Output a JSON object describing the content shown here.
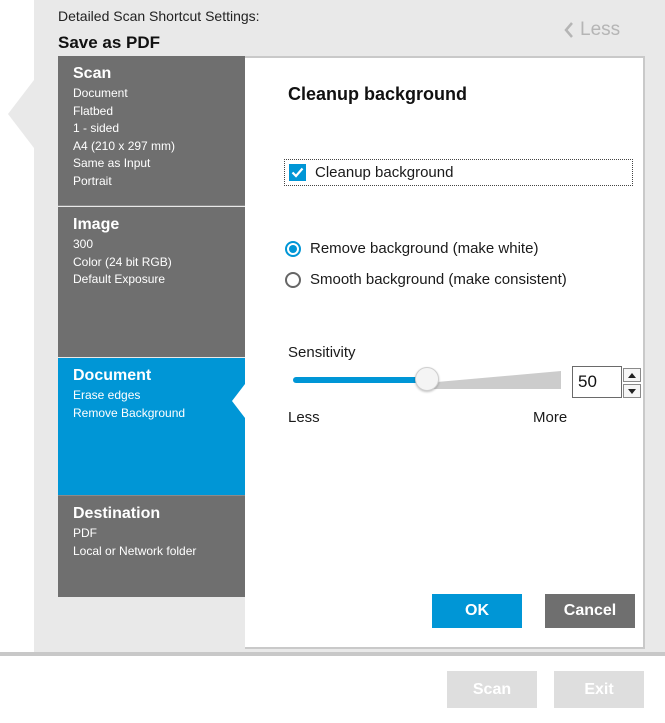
{
  "header": {
    "subtitle": "Detailed Scan Shortcut Settings:",
    "title": "Save as PDF",
    "less_label": "Less"
  },
  "sidebar": {
    "items": [
      {
        "title": "Scan",
        "lines": [
          "Document",
          "Flatbed",
          "1 - sided",
          "A4 (210 x 297 mm)",
          "Same as Input",
          "Portrait"
        ]
      },
      {
        "title": "Image",
        "lines": [
          "300",
          "Color (24 bit RGB)",
          "Default Exposure"
        ]
      },
      {
        "title": "Document",
        "lines": [
          "Erase edges",
          "Remove Background"
        ],
        "active": true
      },
      {
        "title": "Destination",
        "lines": [
          "PDF",
          "Local or Network folder"
        ]
      }
    ]
  },
  "panel": {
    "section_title": "Cleanup background",
    "checkbox": {
      "label": "Cleanup background",
      "checked": true
    },
    "radios": [
      {
        "label": "Remove background (make white)",
        "checked": true
      },
      {
        "label": "Smooth background (make consistent)",
        "checked": false
      }
    ],
    "sensitivity": {
      "label": "Sensitivity",
      "value": "50",
      "fraction": 0.5,
      "min_label": "Less",
      "max_label": "More"
    },
    "ok_label": "OK",
    "cancel_label": "Cancel"
  },
  "footer": {
    "scan_label": "Scan",
    "exit_label": "Exit"
  },
  "colors": {
    "accent": "#0096d6",
    "sidebar_bg": "#6f6f6f",
    "disabled_button": "#dedede"
  },
  "icons": {
    "less": "chevron-left-icon",
    "checkbox": "checkmark-icon",
    "spin_up": "triangle-up-icon",
    "spin_down": "triangle-down-icon"
  }
}
